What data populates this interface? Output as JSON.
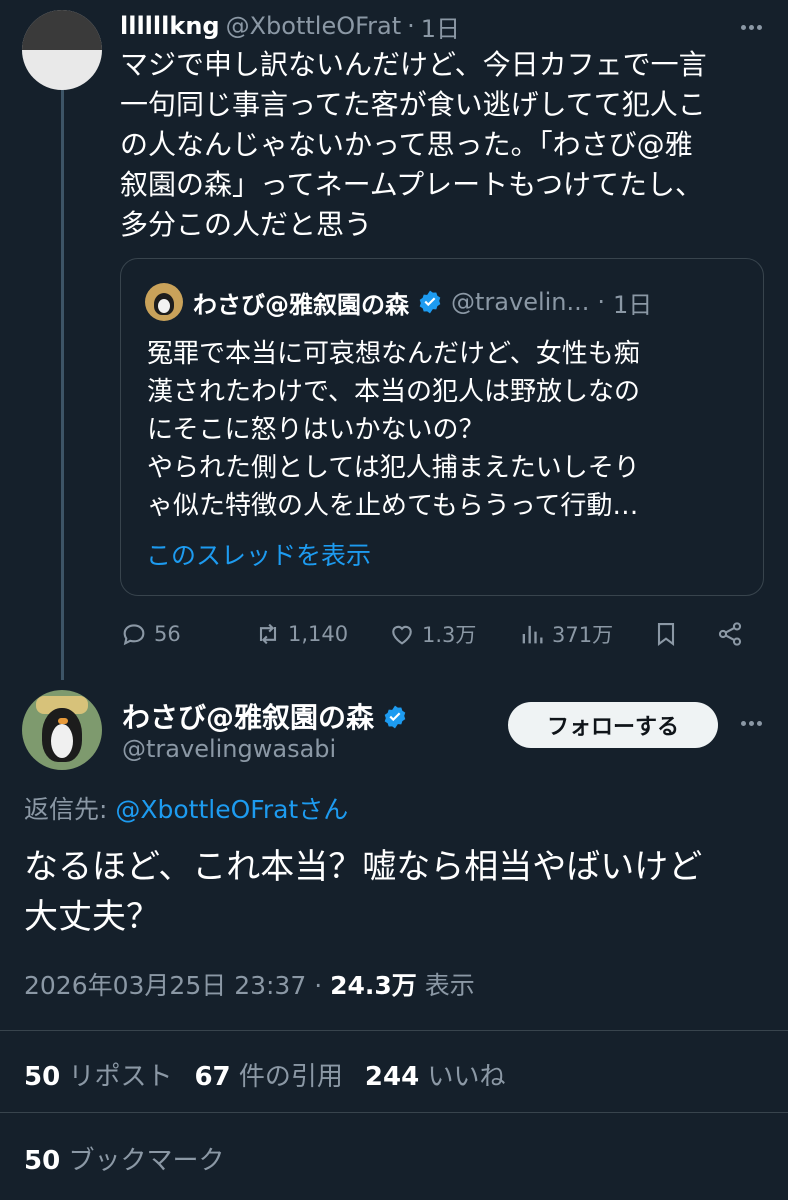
{
  "parent_tweet": {
    "display_name": "llllllkng",
    "handle": "@XbottleOFrat",
    "separator": "·",
    "time": "1日",
    "text": "マジで申し訳ないんだけど、今日カフェで一言\n一句同じ事言ってた客が食い逃げしてて犯人こ\nの人なんじゃないかって思った。「わさび@雅\n叙園の森」ってネームプレートもつけてたし、\n多分この人だと思う",
    "quote": {
      "display_name": "わさび@雅叙園の森",
      "handle": "@travelin...",
      "separator": "·",
      "time": "1日",
      "text": "冤罪で本当に可哀想なんだけど、女性も痴\n漢されたわけで、本当の犯人は野放しなの\nにそこに怒りはいかないの？\nやられた側としては犯人捕まえたいしそり\nゃ似た特徴の人を止めてもらうって行動…",
      "show_thread": "このスレッドを表示"
    },
    "actions": {
      "replies": "56",
      "reposts": "1,140",
      "likes": "1.3万",
      "views": "371万"
    }
  },
  "main_tweet": {
    "display_name": "わさび@雅叙園の森",
    "handle": "@travelingwasabi",
    "follow_label": "フォローする",
    "reply_to_prefix": "返信先: ",
    "reply_to_handle": "@XbottleOFratさん",
    "text": "なるほど、これ本当？嘘なら相当やばいけど\n大丈夫？",
    "timestamp": "2026年03月25日 23:37",
    "meta_separator": " · ",
    "views_count": "24.3万",
    "views_label": " 表示",
    "stats": {
      "reposts_count": "50",
      "reposts_label": " リポスト",
      "quotes_count": "67",
      "quotes_label": " 件の引用",
      "likes_count": "244",
      "likes_label": " いいね"
    },
    "bookmarks_count": "50",
    "bookmarks_label": " ブックマーク"
  },
  "colors": {
    "background": "#15202b",
    "accent": "#1d9bf0",
    "muted": "#8b98a5",
    "border": "#38444d"
  }
}
